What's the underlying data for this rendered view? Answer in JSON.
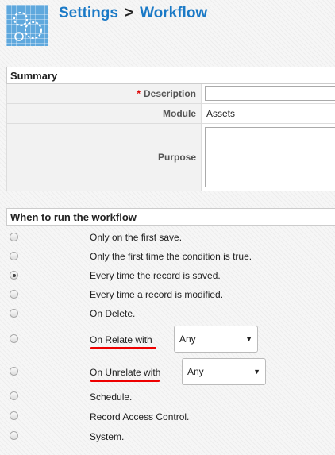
{
  "header": {
    "title_parent": "Settings",
    "separator": ">",
    "title_current": "Workflow"
  },
  "summary": {
    "heading": "Summary",
    "required_marker": "*",
    "description_label": "Description",
    "description_value": "",
    "module_label": "Module",
    "module_value": "Assets",
    "purpose_label": "Purpose",
    "purpose_value": ""
  },
  "when": {
    "heading": "When to run the workflow",
    "options": [
      {
        "label": "Only on the first save.",
        "selected": false
      },
      {
        "label": "Only the first time the condition is true.",
        "selected": false
      },
      {
        "label": "Every time the record is saved.",
        "selected": true
      },
      {
        "label": "Every time a record is modified.",
        "selected": false
      },
      {
        "label": "On Delete.",
        "selected": false
      },
      {
        "label": "On Relate with",
        "selected": false,
        "select_value": "Any"
      },
      {
        "label": "On Unrelate with",
        "selected": false,
        "select_value": "Any"
      },
      {
        "label": "Schedule.",
        "selected": false
      },
      {
        "label": "Record Access Control.",
        "selected": false
      },
      {
        "label": "System.",
        "selected": false
      }
    ]
  },
  "icons": {
    "logo": "workflow-gears-icon",
    "dropdown": "dropdown-arrow-icon"
  },
  "colors": {
    "title": "#1a79c6",
    "required": "#dd0000",
    "highlight_underline": "#ee0000"
  }
}
